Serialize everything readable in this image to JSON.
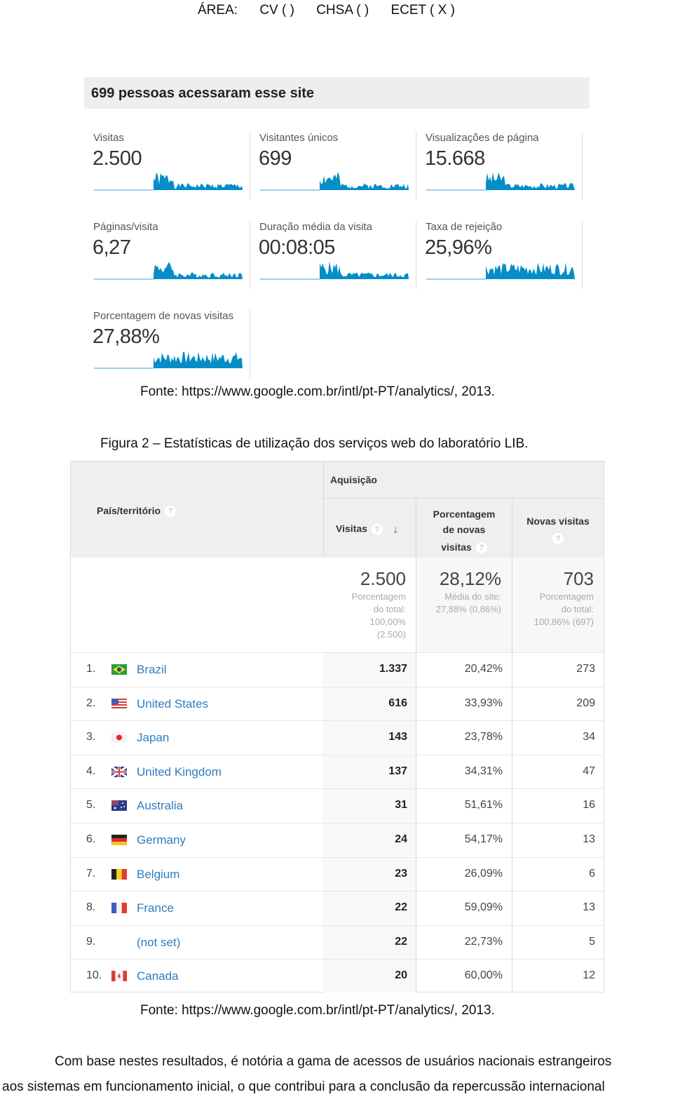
{
  "header_line": {
    "area_label": "ÁREA:",
    "options": [
      "CV (  )",
      "CHSA (  )",
      "ECET ( X )"
    ]
  },
  "summary": {
    "title": "699 pessoas acessaram esse site",
    "sparkline_color": "#058dc7",
    "metrics": [
      {
        "label": "Visitas",
        "value": "2.500"
      },
      {
        "label": "Visitantes únicos",
        "value": "699"
      },
      {
        "label": "Visualizações de página",
        "value": "15.668"
      },
      {
        "label": "Páginas/visita",
        "value": "6,27"
      },
      {
        "label": "Duração média da visita",
        "value": "00:08:05"
      },
      {
        "label": "Taxa de rejeição",
        "value": "25,96%"
      },
      {
        "label": "Porcentagem de novas visitas",
        "value": "27,88%"
      }
    ]
  },
  "source1": "Fonte: https://www.google.com.br/intl/pt-PT/analytics/, 2013.",
  "caption": "Figura 2 – Estatísticas de utilização dos serviços web do laboratório LIB.",
  "table": {
    "dimension_header": "País/território",
    "group_header": "Aquisição",
    "col_visits": "Visitas",
    "col_pct_new_l1": "Porcentagem",
    "col_pct_new_l2": "de novas",
    "col_pct_new_l3": "visitas",
    "col_new_visits": "Novas visitas",
    "help_glyph": "?",
    "sort_glyph": "↓",
    "totals": {
      "visits": "2.500",
      "visits_sub": [
        "Porcentagem",
        "do total:",
        "100,00%",
        "(2.500)"
      ],
      "pct_new": "28,12%",
      "pct_new_sub": [
        "Média do site:",
        "27,88% (0,86%)"
      ],
      "new_visits": "703",
      "new_visits_sub": [
        "Porcentagem",
        "do total:",
        "100,86% (697)"
      ]
    },
    "rows": [
      {
        "rank": "1.",
        "country": "Brazil",
        "flag": "br",
        "visits": "1.337",
        "pct_new": "20,42%",
        "new_visits": "273"
      },
      {
        "rank": "2.",
        "country": "United States",
        "flag": "us",
        "visits": "616",
        "pct_new": "33,93%",
        "new_visits": "209"
      },
      {
        "rank": "3.",
        "country": "Japan",
        "flag": "jp",
        "visits": "143",
        "pct_new": "23,78%",
        "new_visits": "34"
      },
      {
        "rank": "4.",
        "country": "United Kingdom",
        "flag": "gb",
        "visits": "137",
        "pct_new": "34,31%",
        "new_visits": "47"
      },
      {
        "rank": "5.",
        "country": "Australia",
        "flag": "au",
        "visits": "31",
        "pct_new": "51,61%",
        "new_visits": "16"
      },
      {
        "rank": "6.",
        "country": "Germany",
        "flag": "de",
        "visits": "24",
        "pct_new": "54,17%",
        "new_visits": "13"
      },
      {
        "rank": "7.",
        "country": "Belgium",
        "flag": "be",
        "visits": "23",
        "pct_new": "26,09%",
        "new_visits": "6"
      },
      {
        "rank": "8.",
        "country": "France",
        "flag": "fr",
        "visits": "22",
        "pct_new": "59,09%",
        "new_visits": "13"
      },
      {
        "rank": "9.",
        "country": "(not set)",
        "flag": "",
        "visits": "22",
        "pct_new": "22,73%",
        "new_visits": "5"
      },
      {
        "rank": "10.",
        "country": "Canada",
        "flag": "ca",
        "visits": "20",
        "pct_new": "60,00%",
        "new_visits": "12"
      }
    ]
  },
  "source2": "Fonte: https://www.google.com.br/intl/pt-PT/analytics/, 2013.",
  "body_text": [
    "Com base nestes resultados, é notória a gama de acessos de usuários nacionais estrangeiros",
    "aos sistemas em funcionamento inicial, o que contribui para a conclusão da repercussão internacional"
  ]
}
